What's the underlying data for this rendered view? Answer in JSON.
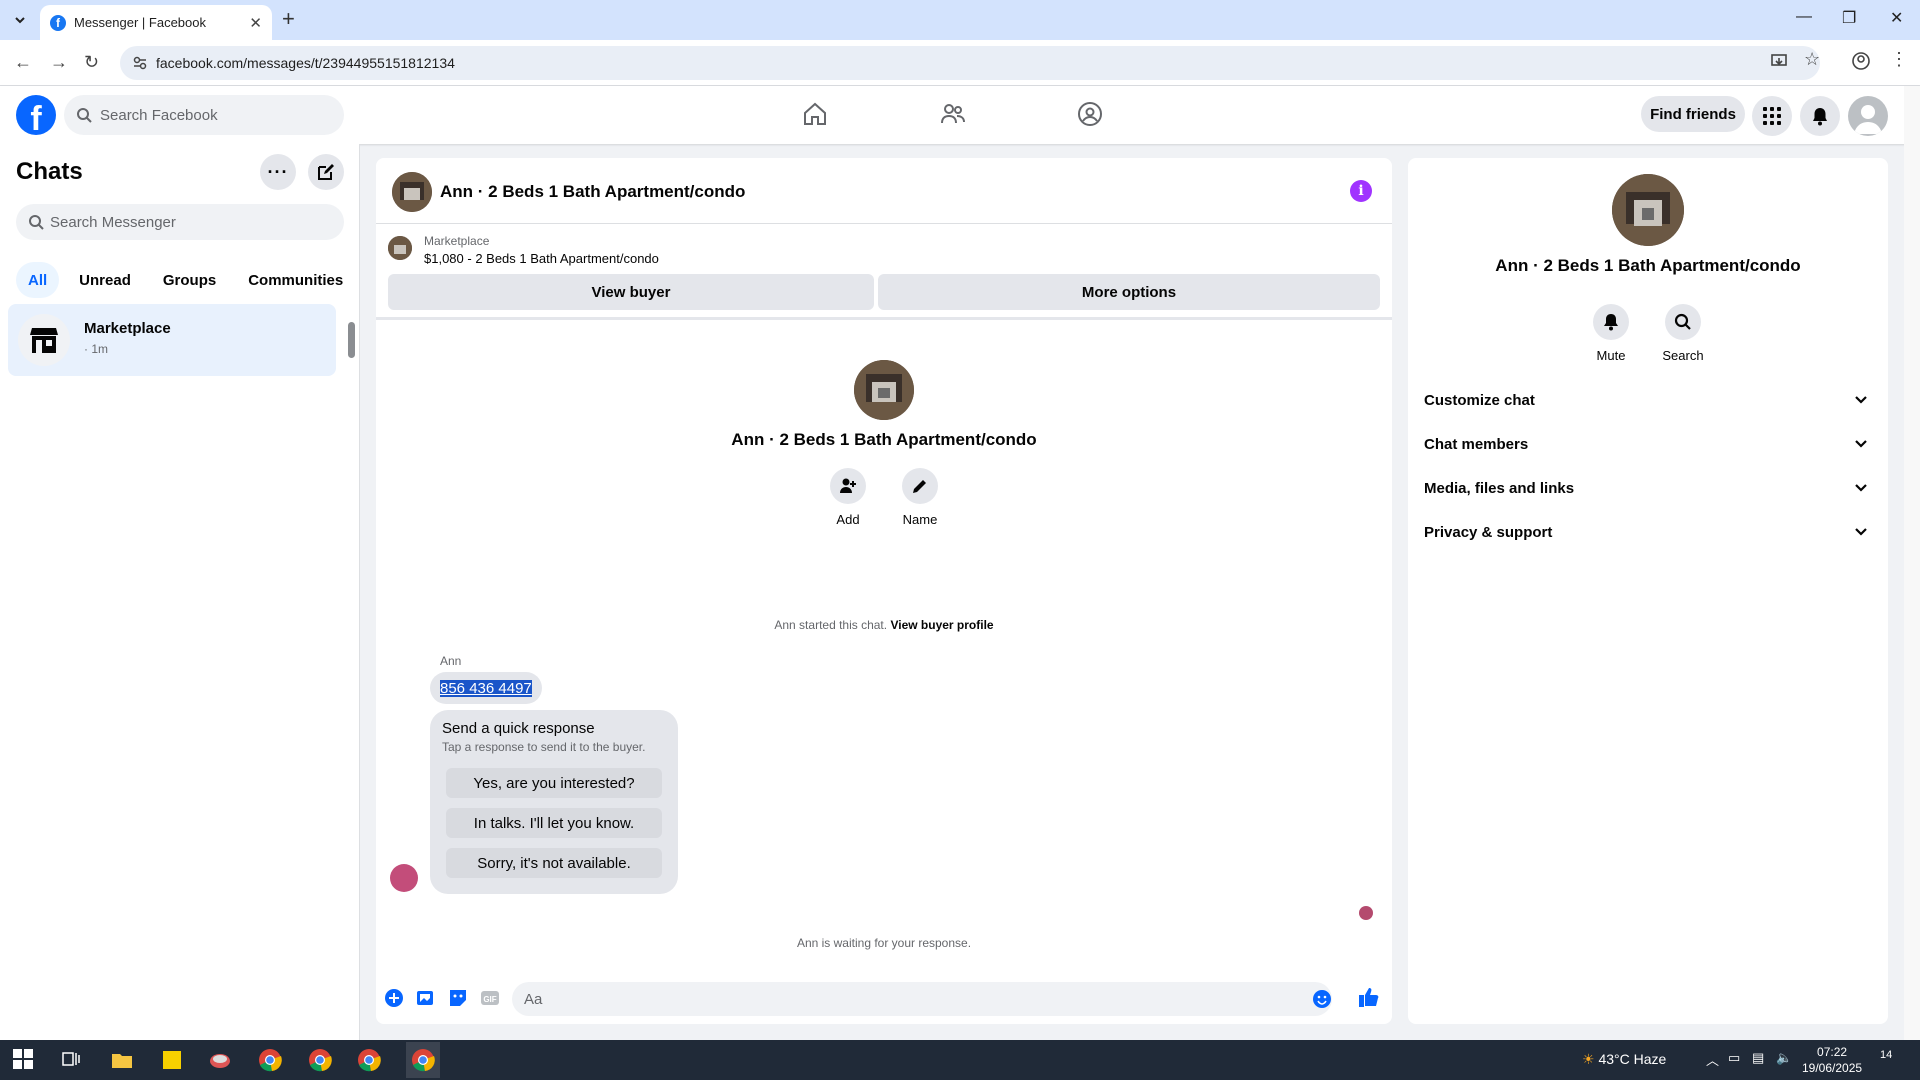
{
  "browser": {
    "tab_title": "Messenger | Facebook",
    "url": "facebook.com/messages/t/23944955151812134"
  },
  "fb": {
    "search_placeholder": "Search Facebook",
    "find_friends": "Find friends"
  },
  "sidebar": {
    "title": "Chats",
    "search_placeholder": "Search Messenger",
    "filters": [
      "All",
      "Unread",
      "Groups",
      "Communities"
    ],
    "active_filter": "All",
    "chats": [
      {
        "name": "Marketplace",
        "time": "· 1m"
      }
    ]
  },
  "conversation": {
    "title": "Ann · 2 Beds 1 Bath Apartment/condo",
    "marketplace_label": "Marketplace",
    "listing": "$1,080 - 2 Beds 1 Bath Apartment/condo",
    "view_buyer": "View buyer",
    "more_options": "More options",
    "intro_title": "Ann · 2 Beds 1 Bath Apartment/condo",
    "add_label": "Add",
    "name_label": "Name",
    "started_text": "Ann started this chat.",
    "view_buyer_profile": "View buyer profile",
    "sender": "Ann",
    "phone": "856 436 4497",
    "quick_title": "Send a quick response",
    "quick_sub": "Tap a response to send it to the buyer.",
    "quick_responses": [
      "Yes, are you interested?",
      "In talks. I'll let you know.",
      "Sorry, it's not available."
    ],
    "waiting": "Ann is waiting for your response.",
    "input_placeholder": "Aa"
  },
  "details": {
    "title": "Ann · 2 Beds 1 Bath Apartment/condo",
    "mute": "Mute",
    "search": "Search",
    "sections": [
      "Customize chat",
      "Chat members",
      "Media, files and links",
      "Privacy & support"
    ]
  },
  "taskbar": {
    "weather": "43°C  Haze",
    "time": "07:22",
    "date": "19/06/2025",
    "notifications": "14"
  },
  "colors": {
    "brand": "#0866ff",
    "info": "#a033ff"
  }
}
